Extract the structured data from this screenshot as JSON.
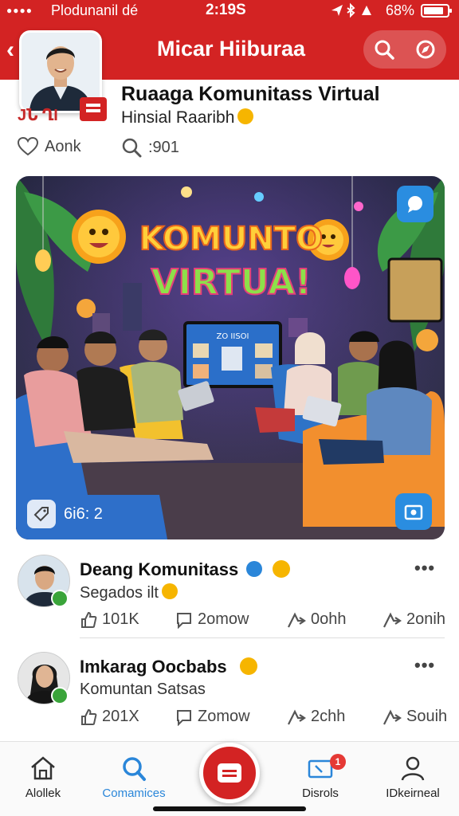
{
  "status_bar": {
    "carrier": "Plodunanil dé",
    "time": "2:19S",
    "battery": "68%"
  },
  "header": {
    "title": "Micar Hiiburaa",
    "icons": [
      "back-arrow-icon",
      "search-icon",
      "compass-icon"
    ]
  },
  "post": {
    "badge_text": "JՆ  ՂI",
    "title": "Ruaaga Komunitass Virtual",
    "subtitle": "Hinsial Raaribh",
    "likes_label": "Aonk",
    "comments_label": ":901",
    "image_tag": "6i6: 2",
    "image_banner_line1": "KOMUNTO",
    "image_banner_line2": "VIRTUA!",
    "image_tv_text": "ZO IISOI"
  },
  "feed": [
    {
      "name": "Deang Komunitass",
      "subtitle": "Segados ilt",
      "more": "•••",
      "actions": [
        "101K",
        "2omow",
        "0ohh",
        "2onih"
      ]
    },
    {
      "name": "Imkarag Oocbabs",
      "subtitle": "Komuntan Satsas",
      "more": "•••",
      "actions": [
        "201X",
        "Zomow",
        "2chh",
        "Souih"
      ]
    }
  ],
  "bottom_nav": [
    {
      "label": "Alollek",
      "icon": "home-icon",
      "active": false
    },
    {
      "label": "Comamices",
      "icon": "search-icon",
      "active": true
    },
    {
      "label": "Disrols",
      "icon": "tv-icon",
      "active": false,
      "badge": "1"
    },
    {
      "label": "IDkeirneal",
      "icon": "person-icon",
      "active": false
    }
  ],
  "colors": {
    "brand_red": "#d32323",
    "accent_blue": "#2a86d9"
  }
}
